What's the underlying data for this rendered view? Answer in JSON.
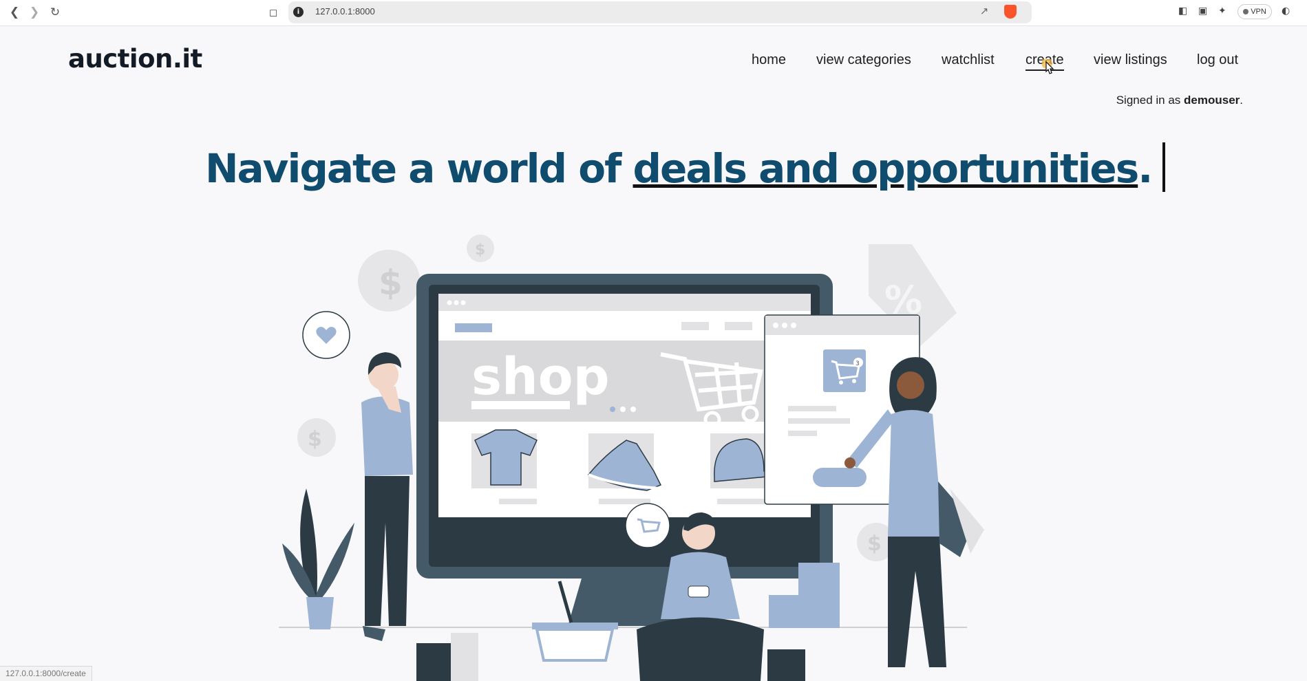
{
  "browser": {
    "url": "127.0.0.1:8000",
    "status_url": "127.0.0.1:8000/create",
    "vpn_label": "VPN",
    "icons": [
      "back-arrow-icon",
      "forward-arrow-icon",
      "reload-icon",
      "bookmark-icon",
      "info-icon",
      "share-icon",
      "brave-shield-icon",
      "sidebar-icon",
      "wallet-icon",
      "leo-ai-icon",
      "vpn-icon",
      "rewards-icon"
    ]
  },
  "site": {
    "logo": "auction.it",
    "nav": [
      {
        "label": "home"
      },
      {
        "label": "view categories"
      },
      {
        "label": "watchlist"
      },
      {
        "label": "create"
      },
      {
        "label": "view listings"
      },
      {
        "label": "log out"
      }
    ],
    "signed_prefix": "Signed in as ",
    "username": "demouser",
    "signed_suffix": "."
  },
  "hero": {
    "lead": "Navigate a world of ",
    "highlight": "deals and opportunities",
    "trail": "."
  },
  "illustration": {
    "screen_word": "shop",
    "cart_badge": "3",
    "accent_color": "#9db4d4",
    "dark_color": "#455a68"
  },
  "colors": {
    "heading": "#0f4c6e",
    "logo": "#131b26",
    "background": "#f8f8fa"
  }
}
